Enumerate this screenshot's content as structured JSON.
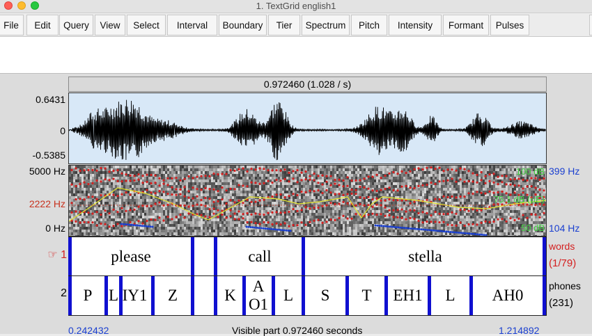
{
  "window": {
    "title": "1. TextGrid english1"
  },
  "menu": [
    {
      "label": "File"
    },
    {
      "label": "Edit"
    },
    {
      "label": "Query"
    },
    {
      "label": "View"
    },
    {
      "label": "Select"
    },
    {
      "label": "Interval"
    },
    {
      "label": "Boundary"
    },
    {
      "label": "Tier"
    },
    {
      "label": "Spectrum"
    },
    {
      "label": "Pitch"
    },
    {
      "label": "Intensity"
    },
    {
      "label": "Formant"
    },
    {
      "label": "Pulses"
    }
  ],
  "selection": {
    "header": "0.972460 (1.028 / s)"
  },
  "waveform": {
    "max_label": "0.6431",
    "zero_label": "0",
    "min_label": "-0.5385"
  },
  "spectrogram": {
    "top_label": "5000 Hz",
    "cursor_label": "2222 Hz",
    "bottom_label": "0 Hz",
    "pitch_top": "399 Hz",
    "pitch_bottom": "104 Hz",
    "intensity_top": "100 dB",
    "intensity_mid": "75.1 dB (µE)",
    "intensity_bottom": "50 dB",
    "colors": {
      "formant": "#d42020",
      "pitch": "#1a3fd0",
      "intensity": "#e8e830",
      "intensity_text": "#40d040"
    }
  },
  "tiers": [
    {
      "number": "☞ 1",
      "name": "words",
      "count": "(1/79)",
      "intervals": [
        {
          "text": "please"
        },
        {
          "text": ""
        },
        {
          "text": "call"
        },
        {
          "text": "stella"
        }
      ]
    },
    {
      "number": "2",
      "name": "phones",
      "count": "(231)",
      "intervals": [
        {
          "text": "P"
        },
        {
          "text": "L"
        },
        {
          "text": "IY1"
        },
        {
          "text": "Z"
        },
        {
          "text": ""
        },
        {
          "text": "K"
        },
        {
          "text": "A"
        },
        {
          "text": "O1"
        },
        {
          "text": "L"
        },
        {
          "text": "S"
        },
        {
          "text": "T"
        },
        {
          "text": "EH1"
        },
        {
          "text": "L"
        },
        {
          "text": "AH0"
        }
      ]
    }
  ],
  "footer": {
    "left_time": "0.242432",
    "visible_text": "Visible part 0.972460 seconds",
    "right_time": "1.214892"
  }
}
